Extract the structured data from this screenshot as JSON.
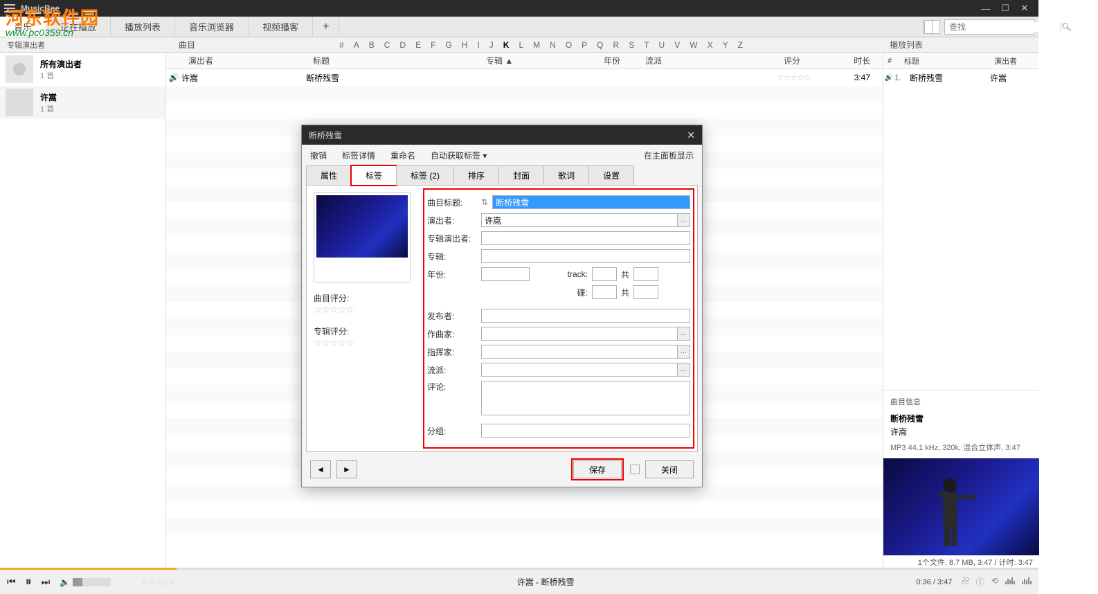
{
  "app": {
    "name": "MusicBee"
  },
  "window_buttons": {
    "min": "—",
    "max": "☐",
    "close": "✕"
  },
  "watermark": {
    "text": "河东软件园",
    "url": "www.pc0359.cn"
  },
  "tabs": {
    "items": [
      "音乐",
      "正在播放",
      "播放列表",
      "音乐浏览器",
      "视频播客"
    ],
    "active_index": 0,
    "search_placeholder": "查找"
  },
  "az_headers": {
    "left": "专辑演出者",
    "tracks": "曲目",
    "right": "播放列表"
  },
  "az_letters": [
    "#",
    "A",
    "B",
    "C",
    "D",
    "E",
    "F",
    "G",
    "H",
    "I",
    "J",
    "K",
    "L",
    "M",
    "N",
    "O",
    "P",
    "Q",
    "R",
    "S",
    "T",
    "U",
    "V",
    "W",
    "X",
    "Y",
    "Z"
  ],
  "az_active": "K",
  "artists": [
    {
      "name": "所有演出者",
      "count": "1 首",
      "placeholder": true
    },
    {
      "name": "许嵩",
      "count": "1 首",
      "placeholder": false
    }
  ],
  "columns": {
    "artist": "演出者",
    "title": "标题",
    "album": "专辑 ▲",
    "year": "年份",
    "genre": "流派",
    "rating": "评分",
    "duration": "时长"
  },
  "tracks": [
    {
      "artist": "许嵩",
      "title": "断桥残雪",
      "album": "",
      "year": "",
      "genre": "",
      "rating": "☆☆☆☆☆",
      "duration": "3:47"
    }
  ],
  "playlist": {
    "columns": {
      "n": "#",
      "title": "标题",
      "artist": "演出者"
    },
    "rows": [
      {
        "n": "1.",
        "title": "断桥残雪",
        "artist": "许嵩"
      }
    ],
    "info_header": "曲目信息",
    "info": {
      "title": "断桥残雪",
      "artist": "许嵩",
      "meta": "MP3 44.1 kHz, 320k, 混合立体声, 3:47"
    },
    "status": "1个文件, 8.7 MB, 3:47 / 计时: 3:47"
  },
  "player": {
    "now_playing": "许嵩 - 断桥残雪",
    "time": "0:36 / 3:47",
    "rating": "☆☆☆☆☆"
  },
  "dialog": {
    "title": "断桥残雪",
    "toolbar": {
      "undo": "撤销",
      "detail": "标签详情",
      "rename": "重命名",
      "auto": "自动获取标签 ▾",
      "show_main": "在主面板显示"
    },
    "tabs": [
      "属性",
      "标签",
      "标签 (2)",
      "排序",
      "封面",
      "歌词",
      "设置"
    ],
    "active_tab_index": 1,
    "left": {
      "track_rating_label": "曲目评分:",
      "album_rating_label": "专辑评分:",
      "stars": "☆☆☆☆☆"
    },
    "form": {
      "labels": {
        "title": "曲目标题:",
        "artist": "演出者:",
        "album_artist": "专辑演出者:",
        "album": "专辑:",
        "year": "年份:",
        "track": "track:",
        "disc": "碟:",
        "total": "共",
        "publisher": "发布者:",
        "composer": "作曲家:",
        "conductor": "指挥家:",
        "genre": "流派:",
        "comment": "评论:",
        "grouping": "分组:"
      },
      "values": {
        "title": "断桥残雪",
        "artist": "许嵩",
        "album_artist": "",
        "album": "",
        "year": "",
        "track": "",
        "track_total": "",
        "disc": "",
        "disc_total": "",
        "publisher": "",
        "composer": "",
        "conductor": "",
        "genre": "",
        "comment": "",
        "grouping": ""
      }
    },
    "footer": {
      "save": "保存",
      "close": "关闭"
    }
  }
}
